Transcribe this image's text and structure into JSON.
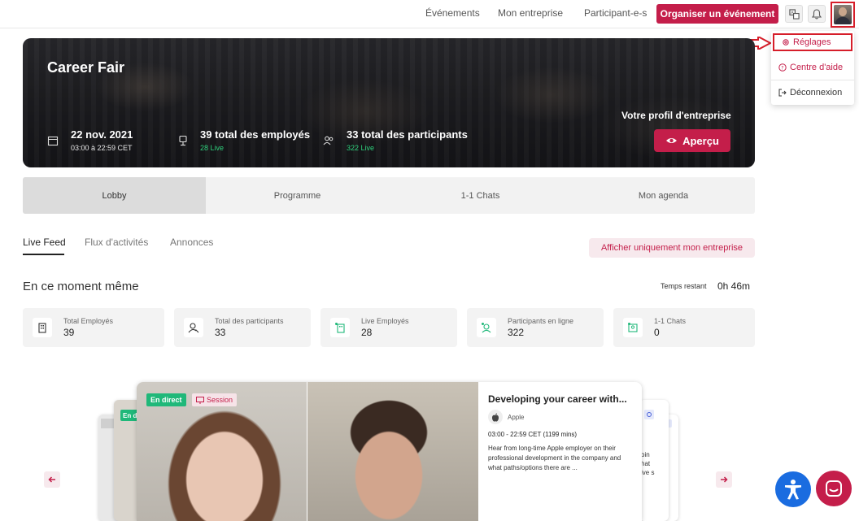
{
  "nav": {
    "links": [
      "Événements",
      "Mon entreprise",
      "Participant-e-s"
    ],
    "cta": "Organiser un événement",
    "icons": [
      "translate-icon",
      "bell-icon",
      "avatar"
    ]
  },
  "dropdown": {
    "items": [
      {
        "label": "Réglages",
        "icon": "gear-icon"
      },
      {
        "label": "Centre d'aide",
        "icon": "help-icon"
      },
      {
        "label": "Déconnexion",
        "icon": "logout-icon"
      }
    ]
  },
  "hero": {
    "title": "Career Fair",
    "date": "22 nov. 2021",
    "time": "03:00 à 22:59 CET",
    "employees": "39 total des employés",
    "employees_live": "28 Live",
    "participants": "33 total des participants",
    "participants_live": "322 Live",
    "profile_label": "Votre profil d'entreprise",
    "preview_button": "Aperçu"
  },
  "tabs": [
    "Lobby",
    "Programme",
    "1-1 Chats",
    "Mon agenda"
  ],
  "subtabs": [
    "Live Feed",
    "Flux d'activités",
    "Annonces"
  ],
  "filter_button": "Afficher uniquement mon entreprise",
  "section": {
    "title": "En ce moment même",
    "time_label": "Temps restant",
    "time_value": "0h 46m"
  },
  "stats": [
    {
      "label": "Total Employés",
      "value": "39"
    },
    {
      "label": "Total des participants",
      "value": "33"
    },
    {
      "label": "Live Employés",
      "value": "28"
    },
    {
      "label": "Participants en ligne",
      "value": "322"
    },
    {
      "label": "1-1 Chats",
      "value": "0"
    }
  ],
  "session": {
    "badge_live": "En direct",
    "badge_type": "Session",
    "title": "Developing your career with...",
    "company": "Apple",
    "time": "03:00 - 22:59 CET (1199 mins)",
    "description": "Hear from long-time Apple employer on their professional development in the company and what paths/options there are ..."
  },
  "back_badge": "En d",
  "back_text": [
    "oin",
    "hat",
    "ive s"
  ],
  "colors": {
    "brand": "#c41e4a",
    "live": "#1fb879",
    "accessibility": "#1a6ce0",
    "highlight": "#d61e2a"
  }
}
